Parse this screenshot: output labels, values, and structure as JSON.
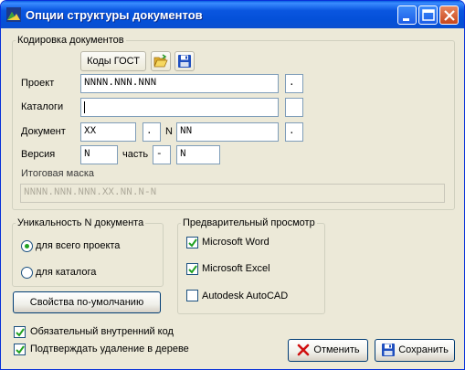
{
  "window": {
    "title": "Опции структуры документов"
  },
  "encoding": {
    "group_label": "Кодировка документов",
    "gost_button": "Коды ГОСТ",
    "open_icon": "folder-open-icon",
    "save_icon": "floppy-disk-icon",
    "project_label": "Проект",
    "project_value": "NNNN.NNN.NNN",
    "project_sep": ".",
    "catalog_label": "Каталоги",
    "catalog_value": "",
    "catalog_sep": "",
    "document_label": "Документ",
    "document_value": "XX",
    "document_sep": ".",
    "n_label": "N",
    "n_value": "NN",
    "n_sep": ".",
    "version_label": "Версия",
    "version_value": "N",
    "part_label": "часть",
    "part_sep": "-",
    "part_value": "N",
    "mask_label": "Итоговая маска",
    "mask_value": "NNNN.NNN.NNN.XX.NN.N-N"
  },
  "uniqueness": {
    "group_label": "Уникальность N документа",
    "options": [
      {
        "label": "для всего проекта",
        "selected": true
      },
      {
        "label": "для каталога",
        "selected": false
      }
    ]
  },
  "preview": {
    "group_label": "Предварительный просмотр",
    "items": [
      {
        "label": "Microsoft Word",
        "checked": true
      },
      {
        "label": "Microsoft Excel",
        "checked": true
      },
      {
        "label": "Autodesk AutoCAD",
        "checked": false
      }
    ]
  },
  "defaults_button": "Свойства по-умолчанию",
  "options": [
    {
      "label": "Обязательный внутренний код",
      "checked": true
    },
    {
      "label": "Подтверждать удаление в дереве",
      "checked": true
    }
  ],
  "cancel_button": "Отменить",
  "save_button": "Сохранить",
  "colors": {
    "titlebar": "#0a56e0",
    "face": "#ece9d8",
    "field_border": "#7f9db9",
    "close_button": "#c8461c"
  }
}
